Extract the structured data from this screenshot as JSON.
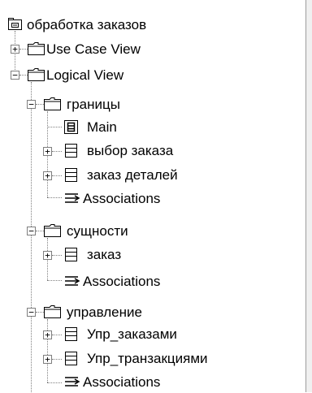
{
  "tree": {
    "root": {
      "label": "обработка заказов",
      "icon": "package-root-icon"
    },
    "use_case_view": {
      "label": "Use Case View",
      "expander": "+",
      "icon": "folder-icon"
    },
    "logical_view": {
      "label": "Logical View",
      "expander": "−",
      "icon": "folder-icon"
    },
    "granitsy": {
      "label": "границы",
      "expander": "−",
      "icon": "folder-icon",
      "items": [
        {
          "label": "Main",
          "icon": "diagram-icon"
        },
        {
          "label": "выбор заказа",
          "expander": "+",
          "icon": "class-icon"
        },
        {
          "label": "заказ деталей",
          "expander": "+",
          "icon": "class-icon"
        },
        {
          "label": "Associations",
          "icon": "associations-icon"
        }
      ]
    },
    "sushchnosti": {
      "label": "сущности",
      "expander": "−",
      "icon": "folder-icon",
      "items": [
        {
          "label": "заказ",
          "expander": "+",
          "icon": "class-icon"
        },
        {
          "label": "Associations",
          "icon": "associations-icon"
        }
      ]
    },
    "upravlenie": {
      "label": "управление",
      "expander": "−",
      "icon": "folder-icon",
      "items": [
        {
          "label": "Упр_заказами",
          "expander": "+",
          "icon": "class-icon"
        },
        {
          "label": "Упр_транзакциями",
          "expander": "+",
          "icon": "class-icon"
        },
        {
          "label": "Associations",
          "icon": "associations-icon"
        }
      ]
    }
  }
}
